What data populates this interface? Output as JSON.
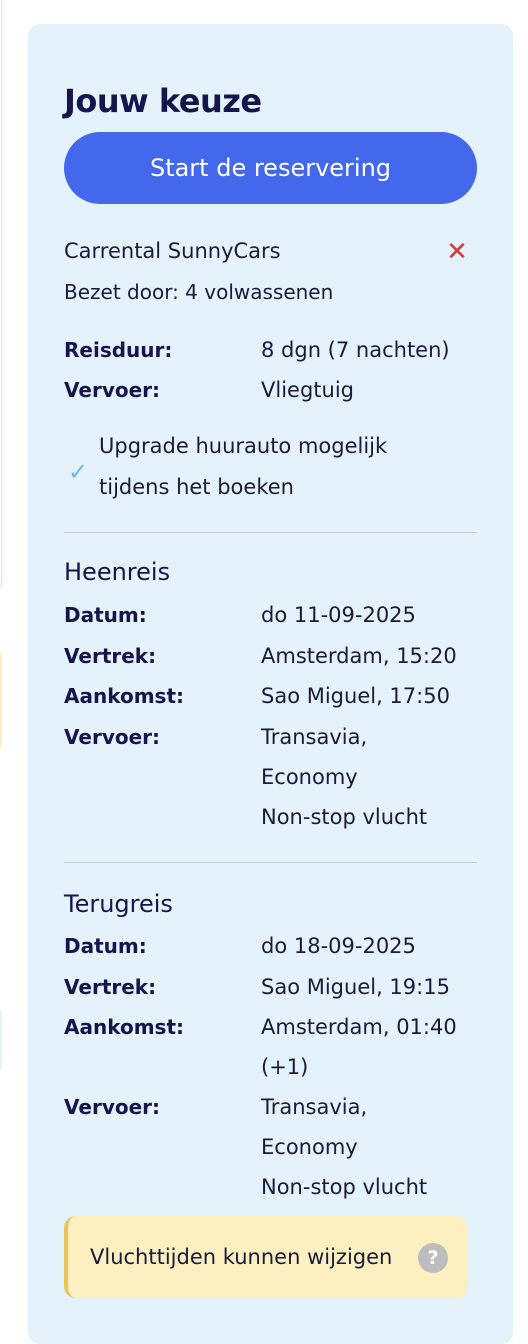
{
  "selection": {
    "title": "Jouw keuze",
    "start_button": "Start de reservering",
    "accommodation": "Carrental SunnyCars",
    "remove_icon": "close-icon",
    "occupancy": "Bezet door: 4 volwassenen",
    "summary": [
      {
        "label": "Reisduur:",
        "value": "8 dgn (7 nachten)"
      },
      {
        "label": "Vervoer:",
        "value": "Vliegtuig"
      }
    ],
    "upgrade_note": [
      "Upgrade huurauto mogelijk",
      "tijdens het boeken"
    ],
    "colors": {
      "panel": "#e4f2fb",
      "button": "#4468ec",
      "remove": "#d33a3a",
      "check": "#6fb8e8",
      "notice": "#fdf0c0"
    }
  },
  "outbound": {
    "heading": "Heenreis",
    "rows": [
      {
        "label": "Datum:",
        "value": [
          "do 11-09-2025"
        ]
      },
      {
        "label": "Vertrek:",
        "value": [
          "Amsterdam, 15:20"
        ]
      },
      {
        "label": "Aankomst:",
        "value": [
          "Sao Miguel, 17:50"
        ]
      },
      {
        "label": "Vervoer:",
        "value": [
          "Transavia,",
          "Economy",
          "Non-stop vlucht"
        ]
      }
    ]
  },
  "return": {
    "heading": "Terugreis",
    "rows": [
      {
        "label": "Datum:",
        "value": [
          "do 18-09-2025"
        ]
      },
      {
        "label": "Vertrek:",
        "value": [
          "Sao Miguel, 19:15"
        ]
      },
      {
        "label": "Aankomst:",
        "value": [
          "Amsterdam, 01:40",
          "(+1)"
        ]
      },
      {
        "label": "Vervoer:",
        "value": [
          "Transavia,",
          "Economy",
          "Non-stop vlucht"
        ]
      }
    ]
  },
  "notice": {
    "text": "Vluchttijden kunnen wijzigen",
    "help_icon": "?"
  }
}
